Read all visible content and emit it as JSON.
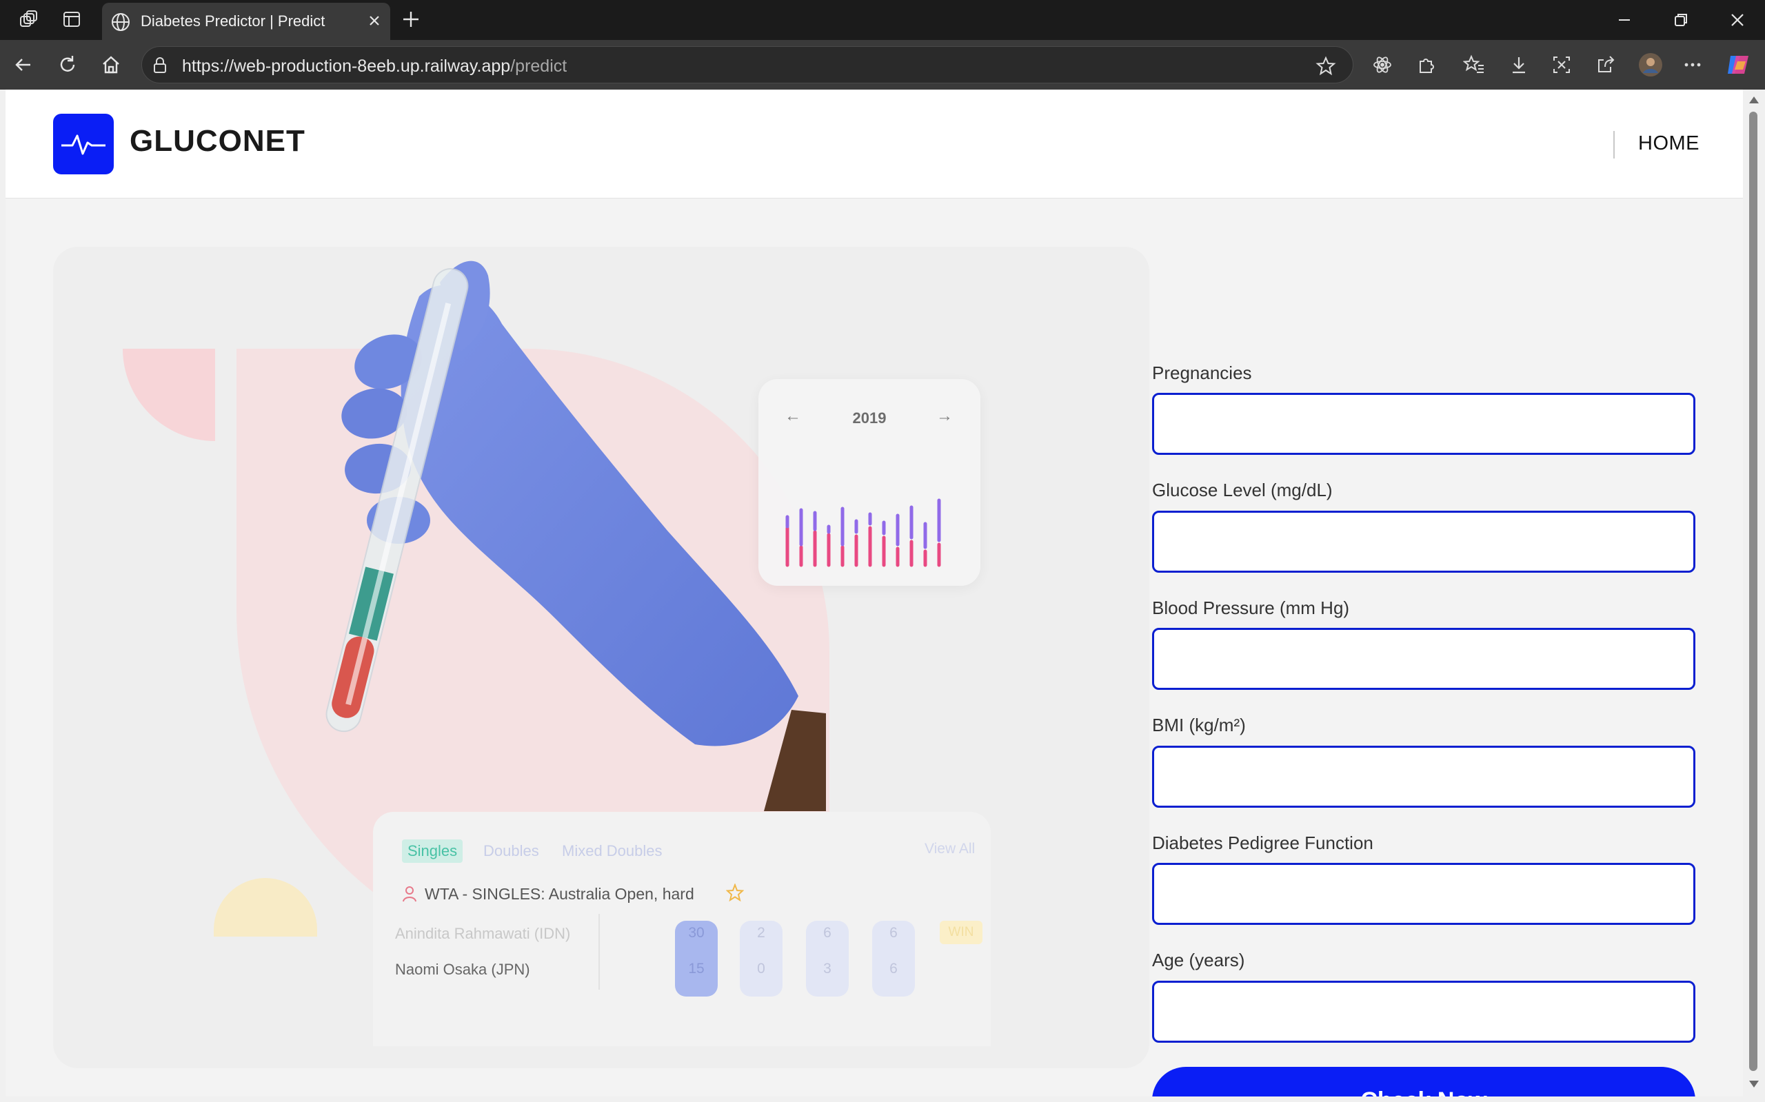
{
  "browser": {
    "tab_title": "Diabetes Predictor | Predict",
    "url_host": "https://web-production-8eeb.up.railway.app",
    "url_path": "/predict"
  },
  "header": {
    "brand": "GLUCONET",
    "nav_home": "HOME"
  },
  "hero": {
    "chart_year": "2019",
    "chart_prev": "←",
    "chart_next": "→",
    "score_tabs": [
      "Singles",
      "Doubles",
      "Mixed Doubles"
    ],
    "view_all": "View All",
    "match_title": "WTA - SINGLES: Australia Open, hard",
    "players": [
      "Anindita Rahmawati (IDN)",
      "Naomi Osaka (JPN)"
    ],
    "scores": [
      [
        "30",
        "15"
      ],
      [
        "2",
        "0"
      ],
      [
        "6",
        "3"
      ],
      [
        "6",
        "6"
      ]
    ],
    "result": "WIN"
  },
  "form": {
    "fields": [
      {
        "label": "Pregnancies",
        "value": ""
      },
      {
        "label": "Glucose Level (mg/dL)",
        "value": ""
      },
      {
        "label": "Blood Pressure (mm Hg)",
        "value": ""
      },
      {
        "label": "BMI (kg/m²)",
        "value": ""
      },
      {
        "label": "Diabetes Pedigree Function",
        "value": ""
      },
      {
        "label": "Age (years)",
        "value": ""
      }
    ],
    "submit_label": "Check Now"
  },
  "colors": {
    "brand_blue": "#0a1ef5",
    "input_border": "#0b1fd0"
  }
}
